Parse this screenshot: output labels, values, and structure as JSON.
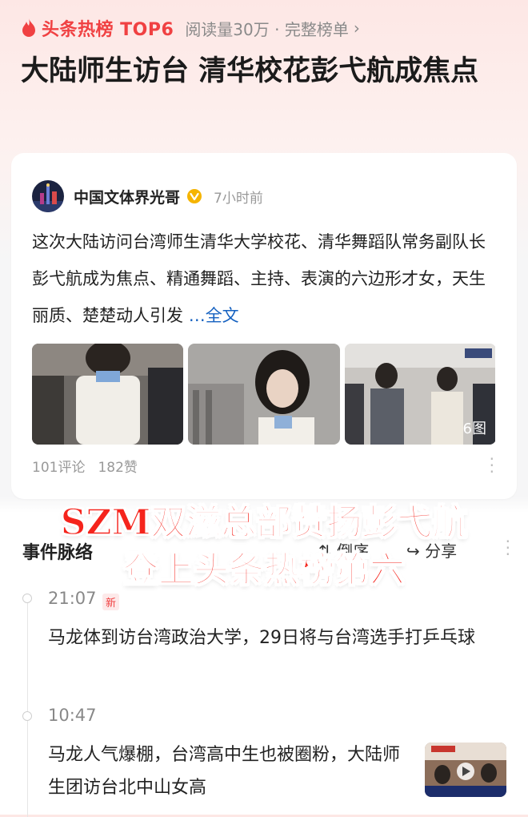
{
  "topbar": {
    "rank_label": "头条热榜 TOP6",
    "meta": "阅读量30万 · 完整榜单",
    "chevron": "›"
  },
  "headline": "大陆师生访台 清华校花彭弋航成焦点",
  "post": {
    "author": "中国文体界光哥",
    "time": "7小时前",
    "excerpt": "这次大陆访问台湾师生清华大学校花、清华舞蹈队常务副队长彭弋航成为焦点、精通舞蹈、主持、表演的六边形才女，天生丽质、楚楚动人引发",
    "more_link": "…全文",
    "image_count": "6图",
    "comments": "101评论",
    "likes": "182赞"
  },
  "events": {
    "title": "事件脉络",
    "sort_label": "倒序",
    "share_label": "分享",
    "items": [
      {
        "time": "21:07",
        "badge": "新",
        "text": "马龙体到访台湾政治大学，29日将与台湾选手打乒乓球"
      },
      {
        "time": "10:47",
        "text": "马龙人气爆棚，台湾高中生也被圈粉，大陆师生团访台北中山女高"
      }
    ]
  },
  "overlay": {
    "line1": "SZM双滋总部赞扬彭弋航",
    "line2": "登上头条热榜第六"
  },
  "colors": {
    "accent": "#f04142",
    "link": "#1561c0",
    "overlay_text": "#f5241c"
  }
}
